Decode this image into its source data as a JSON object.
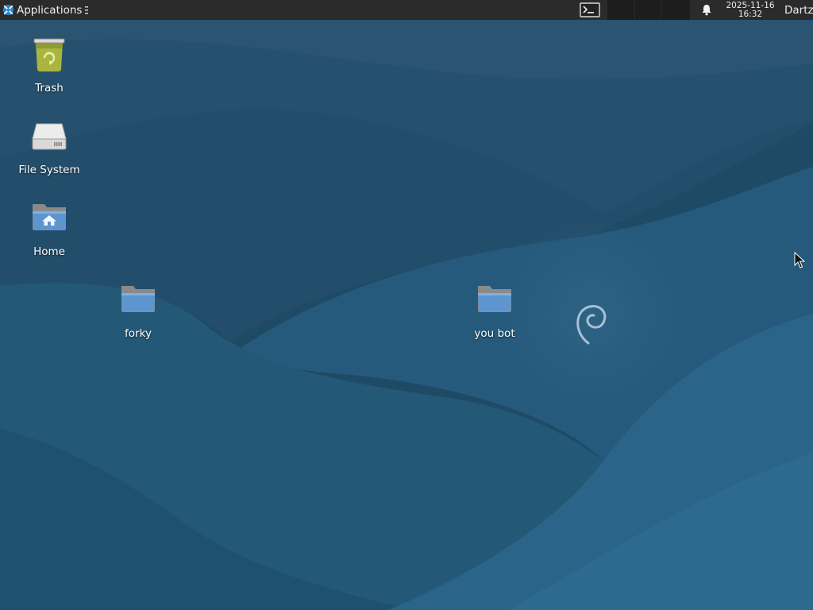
{
  "panel": {
    "applications_label": "Applications",
    "datetime": {
      "date": "2025-11-16",
      "time": "16:32"
    },
    "user_label": "Dartz",
    "icons": {
      "app_menu": "xfce-logo-icon",
      "terminal": "terminal-icon",
      "notifications": "bell-icon"
    }
  },
  "desktop": {
    "icons": [
      {
        "label": "Trash",
        "icon": "trash-icon"
      },
      {
        "label": "File System",
        "icon": "drive-icon"
      },
      {
        "label": "Home",
        "icon": "home-folder-icon"
      },
      {
        "label": "forky",
        "icon": "folder-icon"
      },
      {
        "label": "you bot",
        "icon": "folder-icon"
      }
    ]
  },
  "colors": {
    "panel_bg": "#2b2b2b",
    "wallpaper_base": "#1f4a66",
    "folder_blue": "#5f95cf",
    "trash_green": "#a9b53f"
  }
}
